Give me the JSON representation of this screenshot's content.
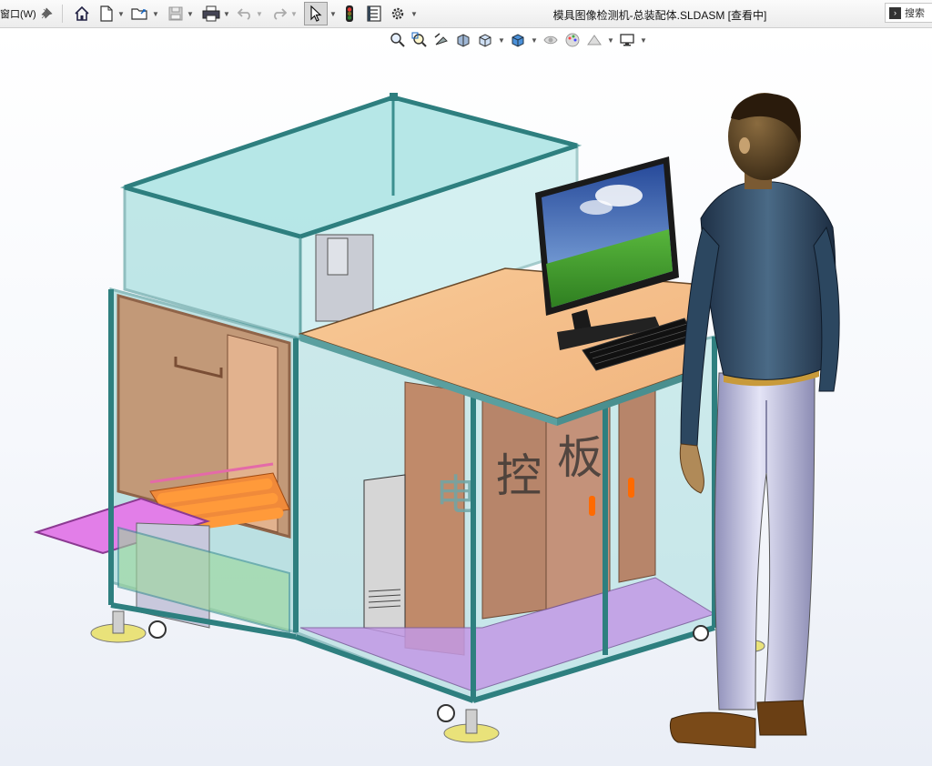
{
  "menu": {
    "window_label": "窗口(W)"
  },
  "toolbar": {
    "icons": [
      "home-icon",
      "new-document-icon",
      "open-folder-icon",
      "save-icon",
      "print-icon",
      "undo-icon",
      "redo-icon",
      "select-pointer-icon",
      "traffic-light-icon",
      "properties-icon",
      "gear-icon"
    ]
  },
  "title": {
    "text": "模具图像检测机-总装配体.SLDASM [查看中]"
  },
  "search": {
    "placeholder": "搜索"
  },
  "view_toolbar": {
    "icons": [
      "zoom-to-fit-icon",
      "zoom-area-icon",
      "previous-view-icon",
      "section-view-icon",
      "view-orientation-icon",
      "display-style-icon",
      "hide-show-icon",
      "edit-appearance-icon",
      "scene-icon",
      "display-settings-icon"
    ]
  },
  "model": {
    "panel_text": [
      "电",
      "控",
      "板"
    ]
  },
  "colors": {
    "frame": "#3b8f8f",
    "glass": "#8fd6d6",
    "table_top": "#f7c28f",
    "panel_brown": "#b7856a",
    "magenta": "#e27ee8",
    "purple_floor": "#c39ae6",
    "feet": "#e9e27a",
    "figure_jacket": "#2c4760",
    "figure_pants": "#b8b8d8"
  }
}
